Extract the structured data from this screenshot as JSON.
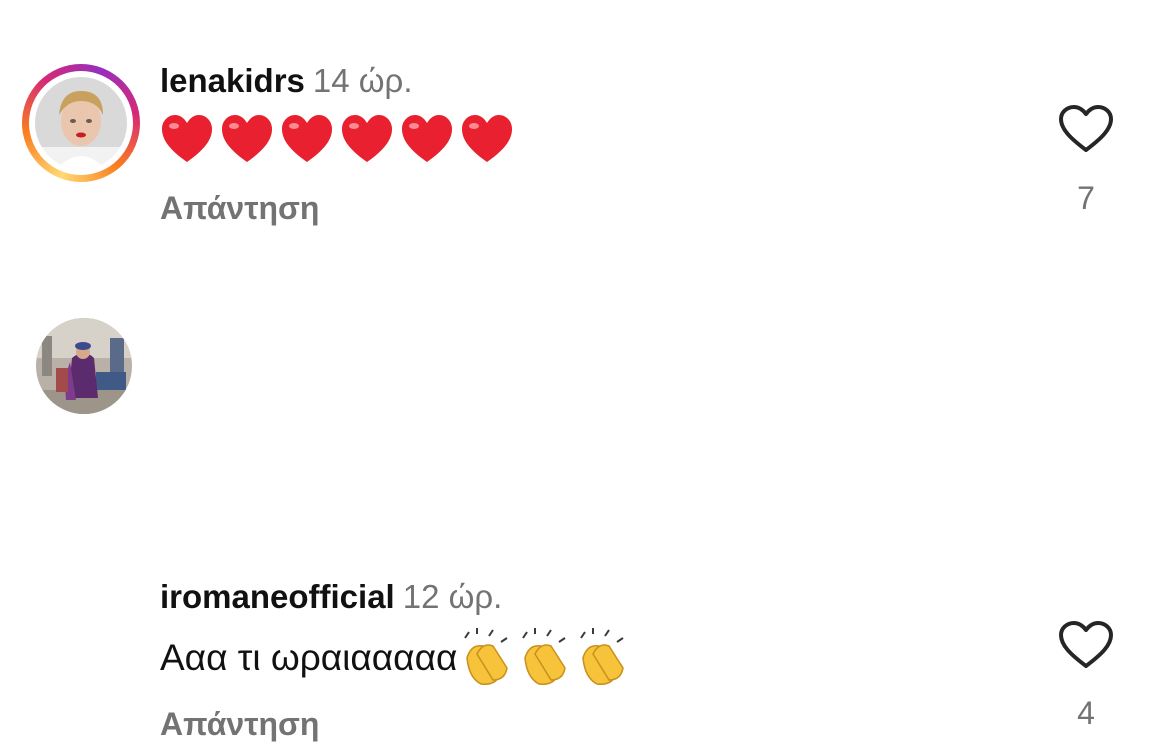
{
  "comments": [
    {
      "username": "lenakidrs",
      "time": "14 ώρ.",
      "text": "",
      "emoji_count": 6,
      "emoji_icon": "red-heart-icon",
      "reply_label": "Απάντηση",
      "likes": "7",
      "has_story_ring": true
    },
    {
      "username": "iromaneofficial",
      "time": "12 ώρ.",
      "text": "Ααα τι ωραιααααα",
      "emoji_count": 3,
      "emoji_icon": "clapping-hands-icon",
      "reply_label": "Απάντηση",
      "likes": "4",
      "has_story_ring": false
    }
  ],
  "colors": {
    "text": "#111111",
    "secondary": "#737373",
    "heart_emoji": "#e8202f",
    "clap_emoji": "#f6c33a"
  }
}
